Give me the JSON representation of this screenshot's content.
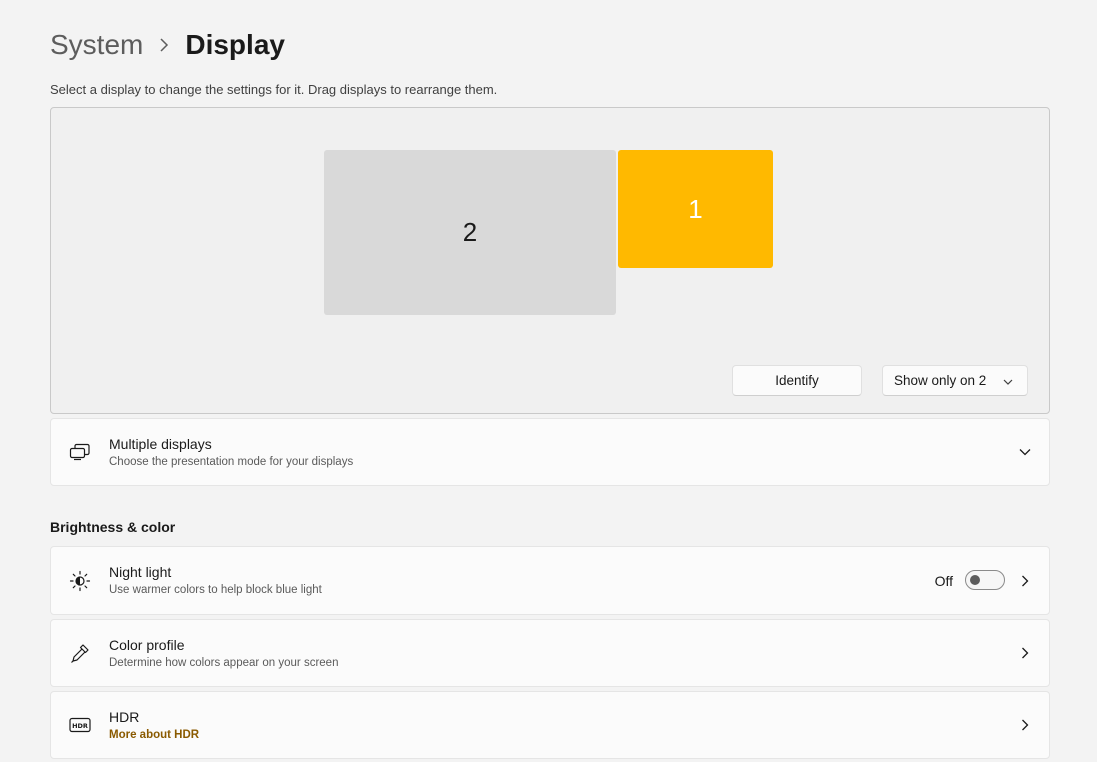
{
  "breadcrumb": {
    "parent": "System",
    "current": "Display"
  },
  "subtitle": "Select a display to change the settings for it. Drag displays to rearrange them.",
  "displays": {
    "monitor_2_label": "2",
    "monitor_1_label": "1",
    "selected_color": "#ffb900",
    "unselected_color": "#d9d9d9"
  },
  "buttons": {
    "identify": "Identify",
    "show_mode": "Show only on 2"
  },
  "multiple_displays": {
    "title": "Multiple displays",
    "description": "Choose the presentation mode for your displays",
    "icon": "multiple-displays-icon"
  },
  "brightness_section": {
    "title": "Brightness & color"
  },
  "night_light": {
    "title": "Night light",
    "description": "Use warmer colors to help block blue light",
    "state": "Off",
    "icon": "night-light-icon"
  },
  "color_profile": {
    "title": "Color profile",
    "description": "Determine how colors appear on your screen",
    "icon": "eyedropper-icon"
  },
  "hdr": {
    "title": "HDR",
    "link": "More about HDR",
    "icon": "hdr-icon",
    "link_color": "#8a5a00"
  }
}
